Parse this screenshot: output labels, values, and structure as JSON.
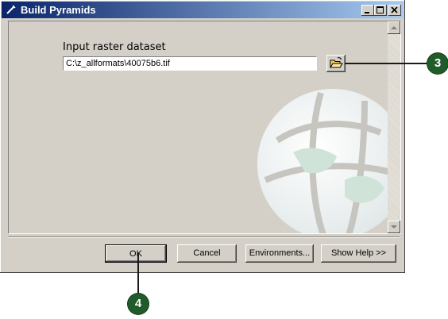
{
  "window": {
    "title": "Build Pyramids",
    "controls": [
      "minimize-icon",
      "maximize-icon",
      "close-icon"
    ]
  },
  "form": {
    "input_label": "Input raster dataset",
    "input_value": "C:\\z_allformats\\40075b6.tif",
    "browse_icon": "open-folder-icon"
  },
  "buttons": {
    "ok": "OK",
    "cancel": "Cancel",
    "environments": "Environments...",
    "show_help": "Show Help >>"
  },
  "callouts": {
    "browse": "3",
    "ok": "4"
  },
  "colors": {
    "title_start": "#0a246a",
    "title_end": "#a6caf0",
    "callout": "#1f5c2a",
    "face": "#d4d0c8"
  }
}
